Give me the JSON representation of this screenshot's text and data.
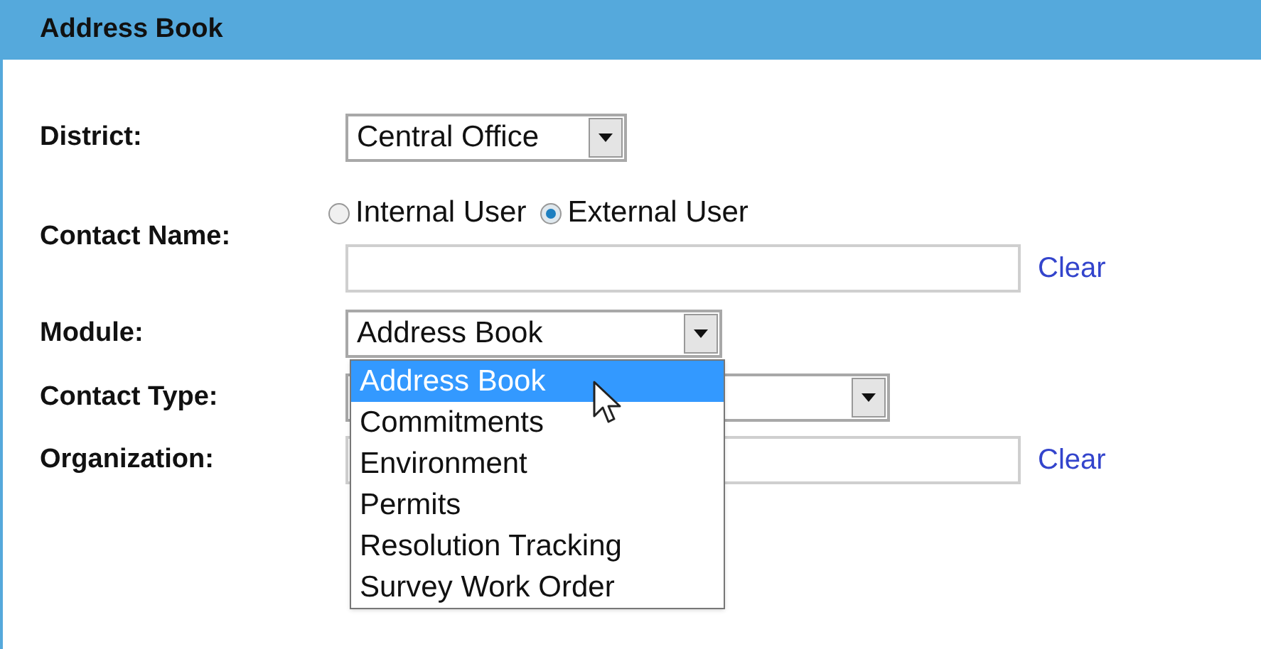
{
  "header": {
    "title": "Address Book"
  },
  "fields": [
    {
      "kind": "select",
      "label": "District:",
      "value": "Central Office"
    },
    {
      "kind": "contact",
      "label": "Contact Name:",
      "radios": [
        {
          "label": "Internal User",
          "selected": false
        },
        {
          "label": "External User",
          "selected": true
        }
      ],
      "link": "Clear"
    },
    {
      "kind": "select",
      "label": "Module:",
      "value": "Address Book",
      "expanded": true,
      "options": [
        {
          "label": "Address Book",
          "selected": true
        },
        {
          "label": "Commitments",
          "selected": false
        },
        {
          "label": "Environment",
          "selected": false
        },
        {
          "label": "Permits",
          "selected": false
        },
        {
          "label": "Resolution Tracking",
          "selected": false
        },
        {
          "label": "Survey Work Order",
          "selected": false
        }
      ]
    },
    {
      "kind": "select",
      "label": "Contact Type:"
    },
    {
      "kind": "text",
      "label": "Organization:",
      "link": "Clear"
    }
  ]
}
